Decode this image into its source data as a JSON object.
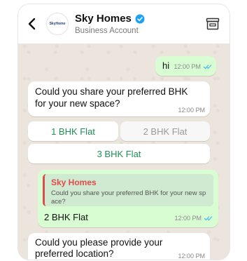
{
  "header": {
    "name": "Sky Homes",
    "subtitle": "Business Account",
    "avatar_logo": "SkyHome"
  },
  "messages": {
    "hi": {
      "text": "hi",
      "time": "12:00 PM"
    },
    "q1": {
      "text": "Could you share your preferred BHK for your new space?",
      "time": "12:00 PM"
    },
    "options": [
      "1 BHK Flat",
      "2 BHK Flat",
      "3 BHK Flat"
    ],
    "reply": {
      "quote_name": "Sky Homes",
      "quote_text": "Could you share your preferred BHK for your new sp ace?",
      "text": "2 BHK Flat",
      "time": "12:00 PM"
    },
    "q2": {
      "text": "Could you please provide your preferred location?",
      "time": "12:00 PM"
    }
  },
  "colors": {
    "chat_background": "#ece5dd",
    "outgoing_bubble": "#d9fdd3",
    "option_text": "#1f8f57",
    "quote_accent": "#e04b4b",
    "read_ticks": "#53bdeb",
    "verified_badge": "#1da1f2"
  },
  "icons": [
    "back-icon",
    "verified-icon",
    "store-icon",
    "double-check-icon"
  ]
}
